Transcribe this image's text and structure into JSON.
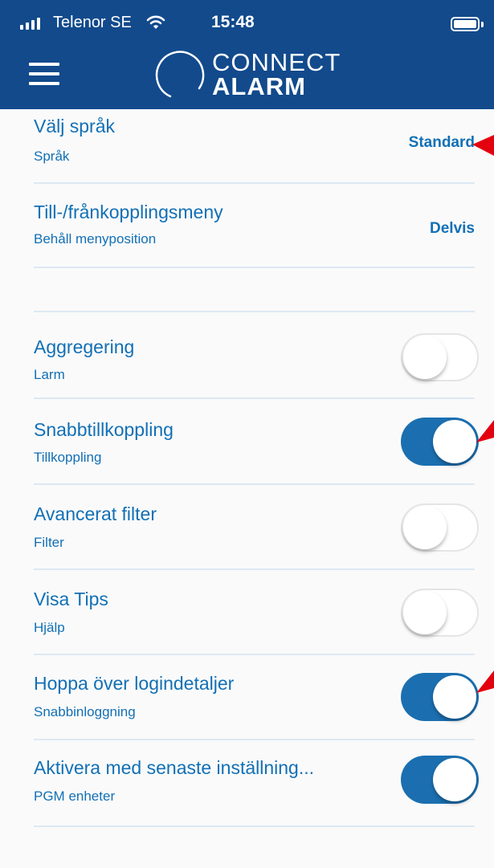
{
  "status_bar": {
    "carrier": "Telenor SE",
    "time": "15:48"
  },
  "app_bar": {
    "menu_icon": "hamburger-menu-icon",
    "logo": {
      "line1": "CONNECT",
      "line2": "ALARM"
    }
  },
  "settings": {
    "language": {
      "title": "Välj språk",
      "subtitle": "Språk",
      "value": "Standard"
    },
    "arm_menu": {
      "title": "Till-/frånkopplingsmeny",
      "subtitle": "Behåll menyposition",
      "value": "Delvis"
    },
    "aggregation": {
      "title": "Aggregering",
      "subtitle": "Larm",
      "enabled": false
    },
    "quick_arm": {
      "title": "Snabbtillkoppling",
      "subtitle": "Tillkoppling",
      "enabled": true
    },
    "advanced_filter": {
      "title": "Avancerat filter",
      "subtitle": "Filter",
      "enabled": false
    },
    "show_tips": {
      "title": "Visa Tips",
      "subtitle": "Hjälp",
      "enabled": false
    },
    "skip_login": {
      "title": "Hoppa över logindetaljer",
      "subtitle": "Snabbinloggning",
      "enabled": true
    },
    "activate_last": {
      "title": "Aktivera med senaste inställning...",
      "subtitle": "PGM enheter",
      "enabled": true
    }
  },
  "colors": {
    "header": "#124a8c",
    "text": "#1270b5",
    "toggle_on": "#1b6fb0",
    "annotation_arrow": "#e3000f"
  }
}
